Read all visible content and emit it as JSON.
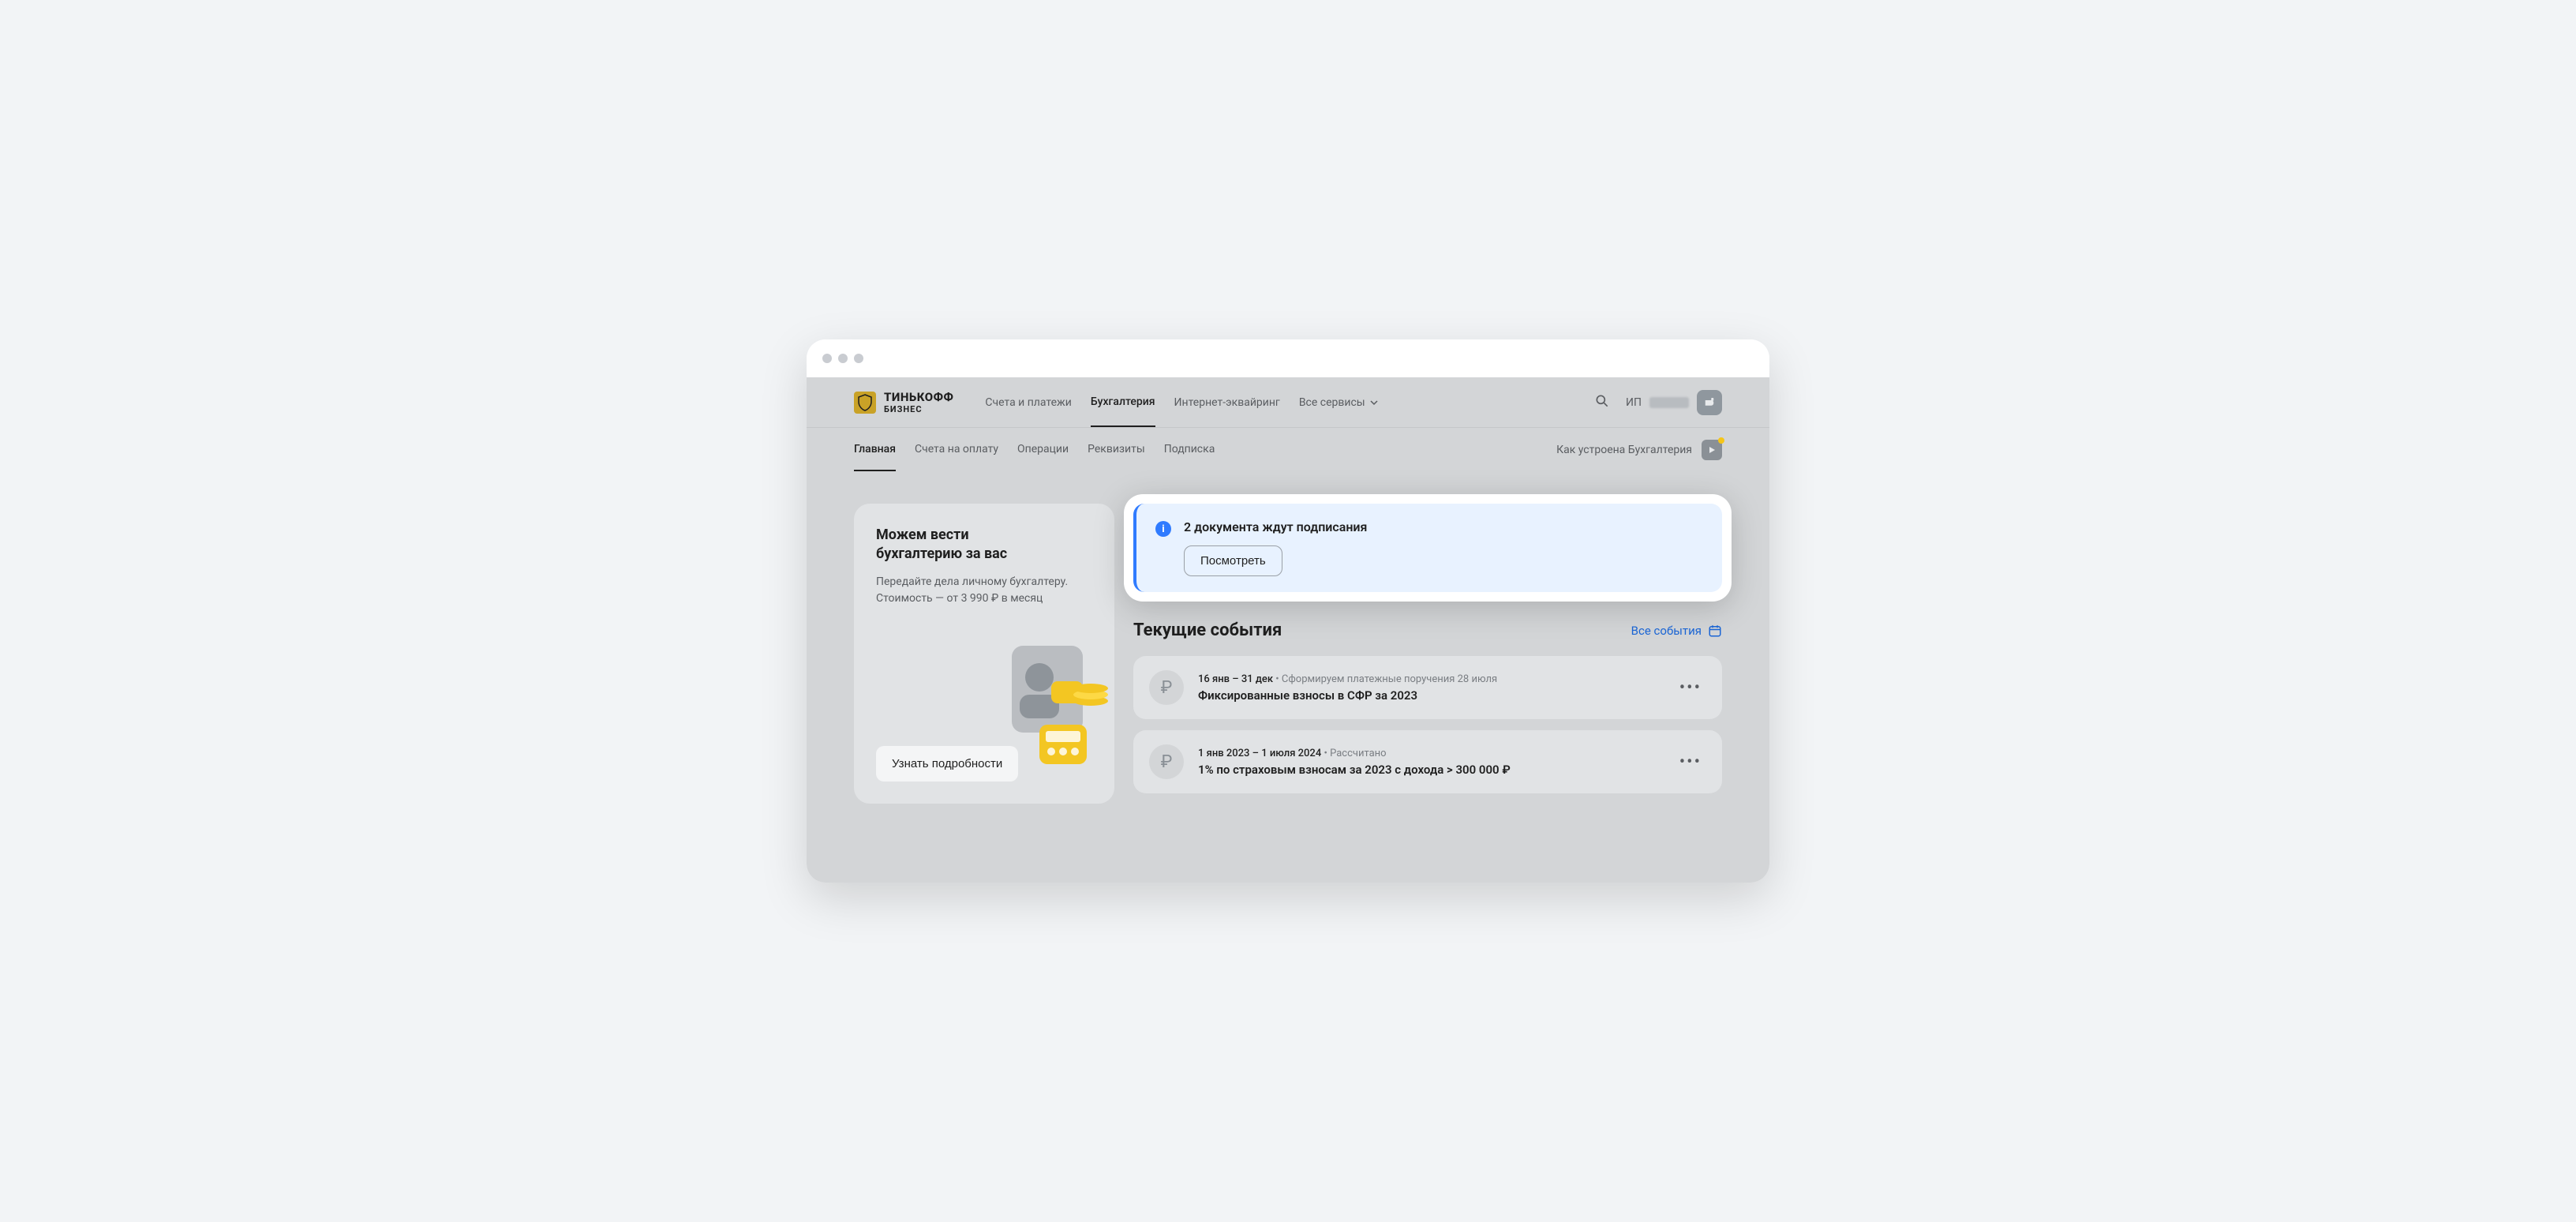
{
  "brand": {
    "line1": "ТИНЬКОФФ",
    "line2": "БИЗНЕС"
  },
  "mainnav": {
    "items": [
      {
        "label": "Счета и платежи"
      },
      {
        "label": "Бухгалтерия"
      },
      {
        "label": "Интернет-эквайринг"
      },
      {
        "label": "Все сервисы"
      }
    ],
    "active_index": 1
  },
  "user": {
    "prefix": "ИП"
  },
  "subnav": {
    "items": [
      {
        "label": "Главная"
      },
      {
        "label": "Счета на оплату"
      },
      {
        "label": "Операции"
      },
      {
        "label": "Реквизиты"
      },
      {
        "label": "Подписка"
      }
    ],
    "active_index": 0,
    "help_label": "Как устроена Бухгалтерия"
  },
  "promo": {
    "title_l1": "Можем вести",
    "title_l2": "бухгалтерию за вас",
    "desc_l1": "Передайте дела личному бухгалтеру.",
    "desc_l2": "Стоимость — от 3 990 ₽ в месяц",
    "cta": "Узнать подробности"
  },
  "alert": {
    "title": "2 документа ждут подписания",
    "cta": "Посмотреть"
  },
  "events": {
    "heading": "Текущие события",
    "all_label": "Все события",
    "items": [
      {
        "date": "16 янв – 31 дек",
        "note": "Сформируем платежные поручения 28 июля",
        "title": "Фиксированные взносы в СФР за 2023"
      },
      {
        "date": "1 янв 2023 – 1 июля 2024",
        "note": "Рассчитано",
        "title": "1% по страховым взносам за 2023 с дохода > 300 000 ₽"
      }
    ]
  }
}
